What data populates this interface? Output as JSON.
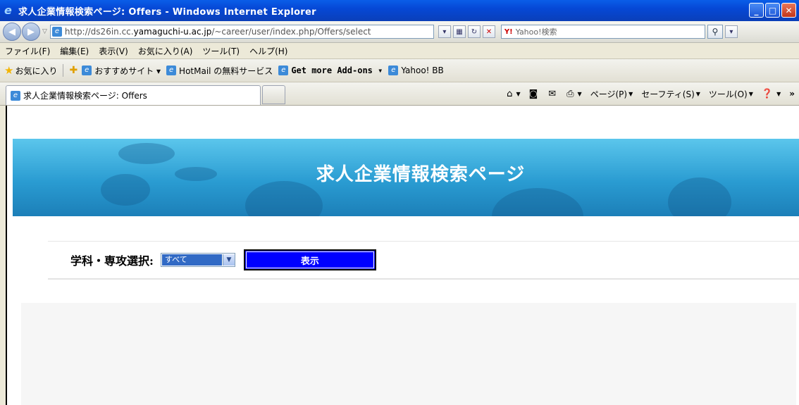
{
  "window": {
    "title": "求人企業情報検索ページ: Offers - Windows Internet Explorer"
  },
  "address_bar": {
    "url_prefix": "http://ds26in.cc.",
    "url_domain": "yamaguchi-u.ac.jp",
    "url_suffix": "/~career/user/index.php/Offers/select",
    "search_placeholder": "Yahoo!検索"
  },
  "menu": [
    "ファイル(F)",
    "編集(E)",
    "表示(V)",
    "お気に入り(A)",
    "ツール(T)",
    "ヘルプ(H)"
  ],
  "favorites_bar": {
    "favorites_label": "お気に入り",
    "links": [
      {
        "label": "おすすめサイト ▾"
      },
      {
        "label": "HotMail の無料サービス"
      },
      {
        "label": "Get more Add-ons ▾"
      },
      {
        "label": "Yahoo! BB"
      }
    ]
  },
  "tab": {
    "title": "求人企業情報検索ページ: Offers"
  },
  "command_bar": {
    "page_label": "ページ(P)",
    "safety_label": "セーフティ(S)",
    "tools_label": "ツール(O)",
    "more": "»"
  },
  "page": {
    "heading": "求人企業情報検索ページ",
    "form_label": "学科・専攻選択:",
    "select_value": "すべて",
    "submit_label": "表示"
  }
}
